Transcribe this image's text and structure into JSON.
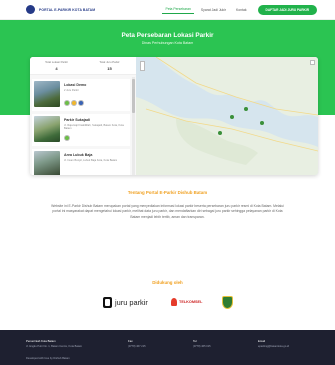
{
  "header": {
    "brand": "PORTAL E-PARKIR KOTA BATAM",
    "nav": [
      "Peta Persebaran",
      "Syarat Jadi Jukir",
      "Kontak"
    ],
    "cta": "DAFTAR JADI JURU PARKIR"
  },
  "hero": {
    "title": "Peta Persebaran Lokasi Parkir",
    "subtitle": "Dinas Perhubungan Kota Batam"
  },
  "stats": [
    {
      "label": "Total Lokasi Parkir",
      "value": "4"
    },
    {
      "label": "Total Juru Parkir",
      "value": "15"
    }
  ],
  "locations": [
    {
      "title": "Lokasi Demo",
      "desc": "2 Juru Parkir"
    },
    {
      "title": "Parkir Sukajadi",
      "desc": "Jl. Raja Haji Fisabilillah, Sukajadi, Batam Kota, Kota Batam"
    },
    {
      "title": "Area Lubuk Baja",
      "desc": "Jl. Imam Bonjol, Lubuk Baja Kota, Kota Batam"
    }
  ],
  "about": {
    "title": "Tentang Portal E-Parkir Dishub Batam",
    "text": "Website ini E-Parkir Dishub Batam merupakan portal yang menyediakan informasi lokasi parkir beserta persebaran juru parkir resmi di Kota Batam. Melalui portal ini masyarakat dapat mengetahui lokasi parkir, melihat data juru parkir, dan mendaftarkan diri sebagai juru parkir sehingga pelayanan parkir di Kota Batam menjadi lebih tertib, aman dan transparan."
  },
  "support": {
    "title": "Didukung oleh",
    "logos": [
      "juru parkir",
      "TELKOMSEL"
    ]
  },
  "footer": {
    "col1_label": "Pemerintah Kota Batam",
    "col1_value": "Jl. Engku Putri No. 1, Batam Centre, Kota Batam",
    "col2_label": "Fax",
    "col2_value": "(0778) 467 215",
    "col3_label": "Tel",
    "col3_value": "(0778) 465 015",
    "col4_label": "Email",
    "col4_value": "eparking@batamkota.go.id",
    "developer": "Developed with love by Dishub Batam"
  },
  "colors": {
    "primary": "#2bc452",
    "accent": "#f0a020",
    "brand": "#253a87",
    "footer": "#1e2030"
  }
}
